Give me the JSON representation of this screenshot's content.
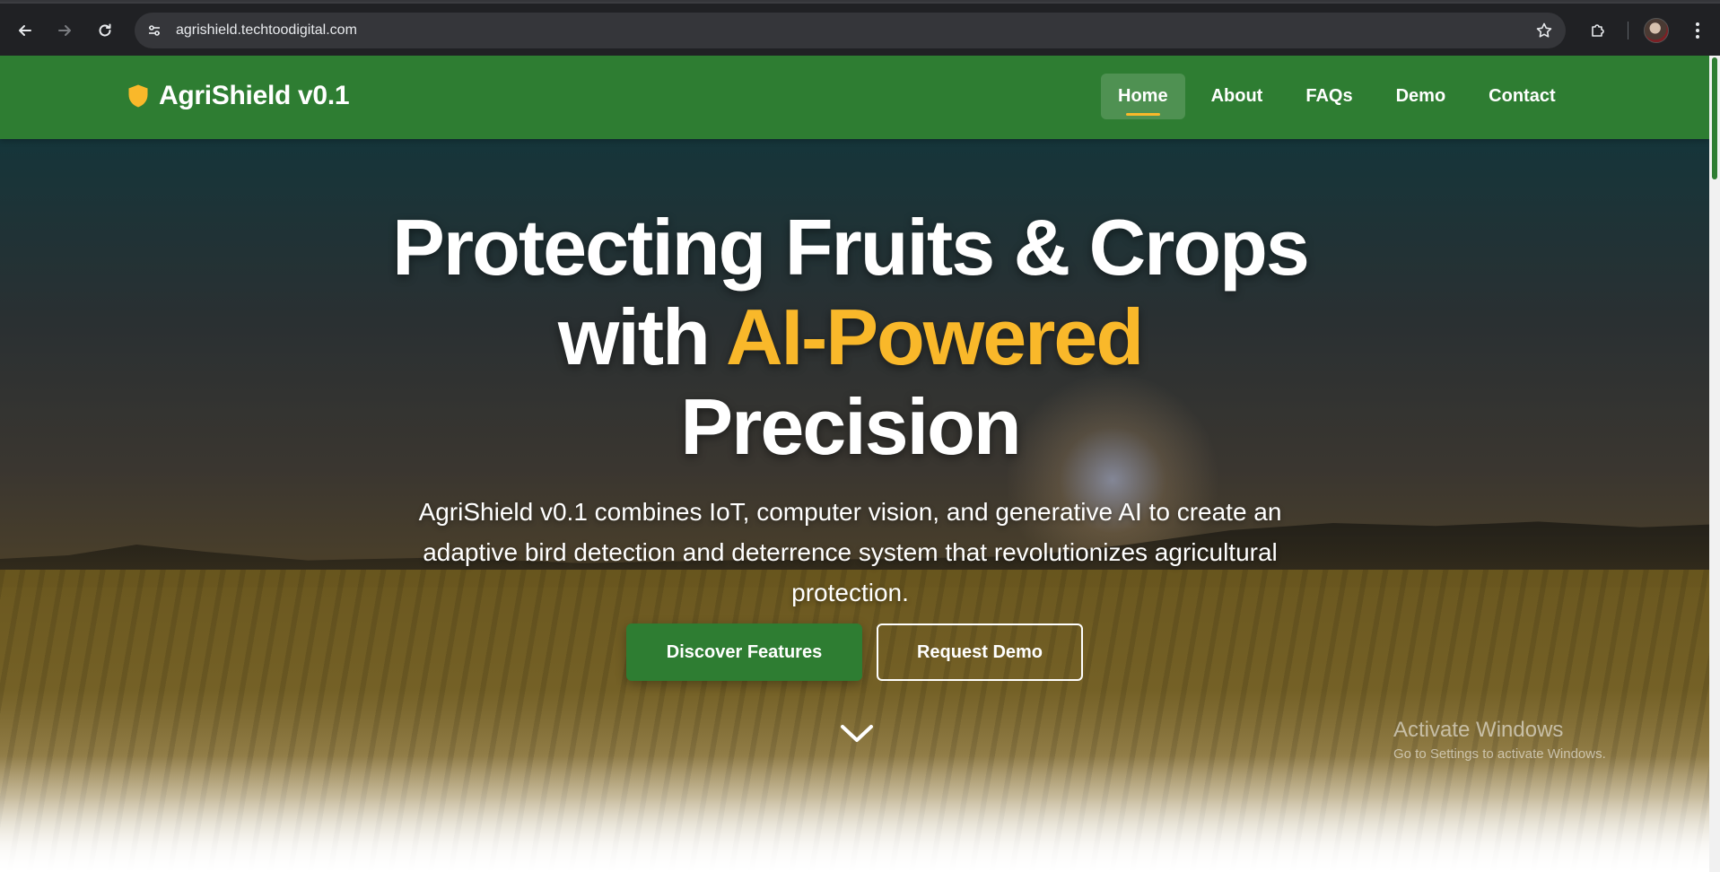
{
  "browser": {
    "url": "agrishield.techtoodigital.com"
  },
  "site": {
    "brand_name": "AgriShield v0.1",
    "accent_color": "#f9b82a",
    "header_color": "#2e7d32",
    "nav": [
      {
        "label": "Home",
        "active": true
      },
      {
        "label": "About"
      },
      {
        "label": "FAQs"
      },
      {
        "label": "Demo"
      },
      {
        "label": "Contact"
      }
    ]
  },
  "hero": {
    "title_line1": "Protecting Fruits & Crops",
    "title_line2_prefix": "with ",
    "title_line2_accent": "AI-Powered",
    "title_line3": "Precision",
    "subtitle": "AgriShield v0.1 combines IoT, computer vision, and generative AI to create an adaptive bird detection and deterrence system that revolutionizes agricultural protection.",
    "primary_button": "Discover Features",
    "secondary_button": "Request Demo",
    "scroll_icon": "chevron-down-icon"
  },
  "os_watermark": {
    "title": "Activate Windows",
    "subtitle": "Go to Settings to activate Windows."
  }
}
